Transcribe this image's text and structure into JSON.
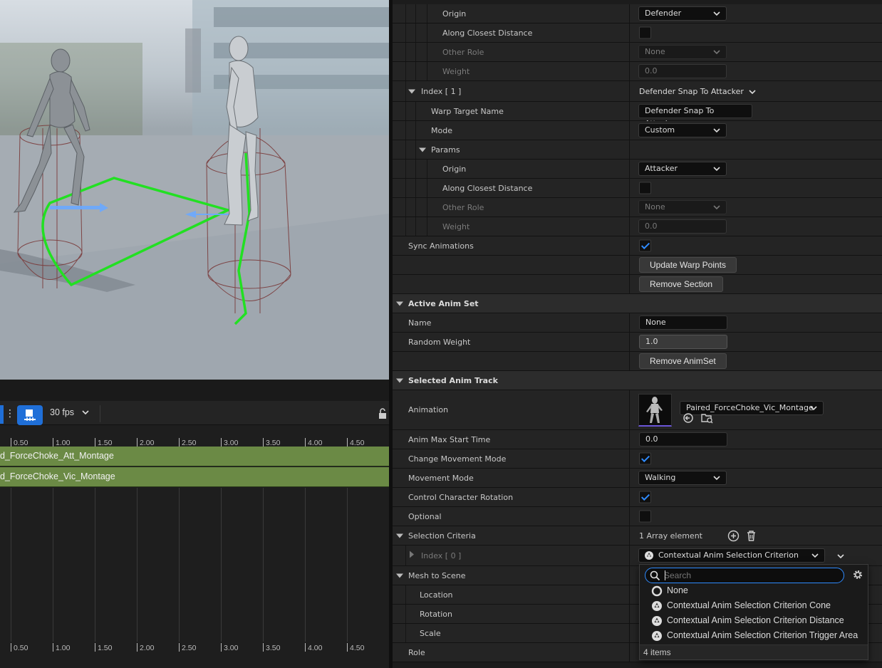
{
  "colors": {
    "accent_blue": "#1f6fd8",
    "track_green": "#6b8a45",
    "checkbox_blue": "#2f8bff",
    "warp_green": "#22e022",
    "capsule_red": "#7a3a3a"
  },
  "timeline": {
    "fps_label": "30 fps",
    "ruler_labels": [
      "0.50",
      "1.00",
      "1.50",
      "2.00",
      "2.50",
      "3.00",
      "3.50",
      "4.00",
      "4.50"
    ],
    "tracks": [
      "d_ForceChoke_Att_Montage",
      "d_ForceChoke_Vic_Montage"
    ]
  },
  "details": {
    "index0_params": {
      "origin_label": "Origin",
      "origin_value": "Defender",
      "along_label": "Along Closest Distance",
      "other_role_label": "Other Role",
      "other_role_value": "None",
      "weight_label": "Weight",
      "weight_value": "0.0"
    },
    "index1": {
      "label": "Index [ 1 ]",
      "value": "Defender Snap To Attacker",
      "warp_target_label": "Warp Target Name",
      "warp_target_value": "Defender Snap To Attacker",
      "mode_label": "Mode",
      "mode_value": "Custom",
      "params_label": "Params",
      "origin_label": "Origin",
      "origin_value": "Attacker",
      "along_label": "Along Closest Distance",
      "other_role_label": "Other Role",
      "other_role_value": "None",
      "weight_label": "Weight",
      "weight_value": "0.0"
    },
    "sync_label": "Sync Animations",
    "update_warp_button": "Update Warp Points",
    "remove_section_button": "Remove Section",
    "active_anim_set": {
      "header": "Active Anim Set",
      "name_label": "Name",
      "name_value": "None",
      "random_weight_label": "Random Weight",
      "random_weight_value": "1.0",
      "remove_animset_button": "Remove AnimSet"
    },
    "selected_anim_track": {
      "header": "Selected Anim Track",
      "animation_label": "Animation",
      "animation_value": "Paired_ForceChoke_Vic_Montage",
      "max_start_label": "Anim Max Start Time",
      "max_start_value": "0.0",
      "change_movement_label": "Change Movement Mode",
      "movement_mode_label": "Movement Mode",
      "movement_mode_value": "Walking",
      "control_rotation_label": "Control Character Rotation",
      "optional_label": "Optional",
      "selection_criteria_label": "Selection Criteria",
      "selection_criteria_value": "1 Array element",
      "index0_label": "Index [ 0 ]",
      "index0_value": "Contextual Anim Selection Criterion Cone",
      "mesh_to_scene_label": "Mesh to Scene",
      "location_label": "Location",
      "rotation_label": "Rotation",
      "scale_label": "Scale",
      "role_label": "Role"
    }
  },
  "popup": {
    "search_placeholder": "Search",
    "items": [
      "None",
      "Contextual Anim Selection Criterion Cone",
      "Contextual Anim Selection Criterion Distance",
      "Contextual Anim Selection Criterion Trigger Area"
    ],
    "footer": "4 items"
  }
}
